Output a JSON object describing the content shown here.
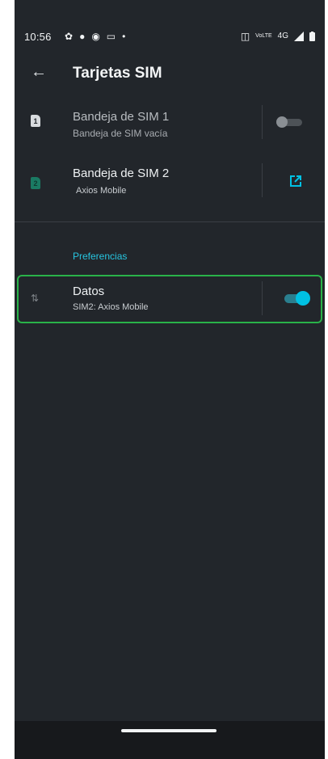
{
  "status_bar": {
    "time": "10:56",
    "left_icons": [
      "gear-icon",
      "app-icon",
      "motorola-icon",
      "cast-icon",
      "dot-icon"
    ],
    "right_icons": [
      "vibrate-icon",
      "volte-icon",
      "4g-icon",
      "signal-icon",
      "battery-icon"
    ],
    "network_label": "4G",
    "volte_label": "VoLTE"
  },
  "app_bar": {
    "title": "Tarjetas SIM",
    "back_icon": "back-arrow-icon"
  },
  "sim_slots": [
    {
      "slot_number": "1",
      "title": "Bandeja de SIM 1",
      "subtitle": "Bandeja de SIM vacía",
      "control": "toggle",
      "enabled": false
    },
    {
      "slot_number": "2",
      "title": "Bandeja de SIM 2",
      "subtitle": "Axios Mobile",
      "control": "open-in-new-icon",
      "enabled": true
    }
  ],
  "preferences": {
    "header": "Preferencias",
    "data": {
      "title": "Datos",
      "subtitle": "SIM2:  Axios Mobile",
      "enabled": true
    }
  },
  "colors": {
    "background": "#22262b",
    "accent": "#00c1e3",
    "highlight_border": "#29b249",
    "sim2_badge": "#1a7a63"
  }
}
